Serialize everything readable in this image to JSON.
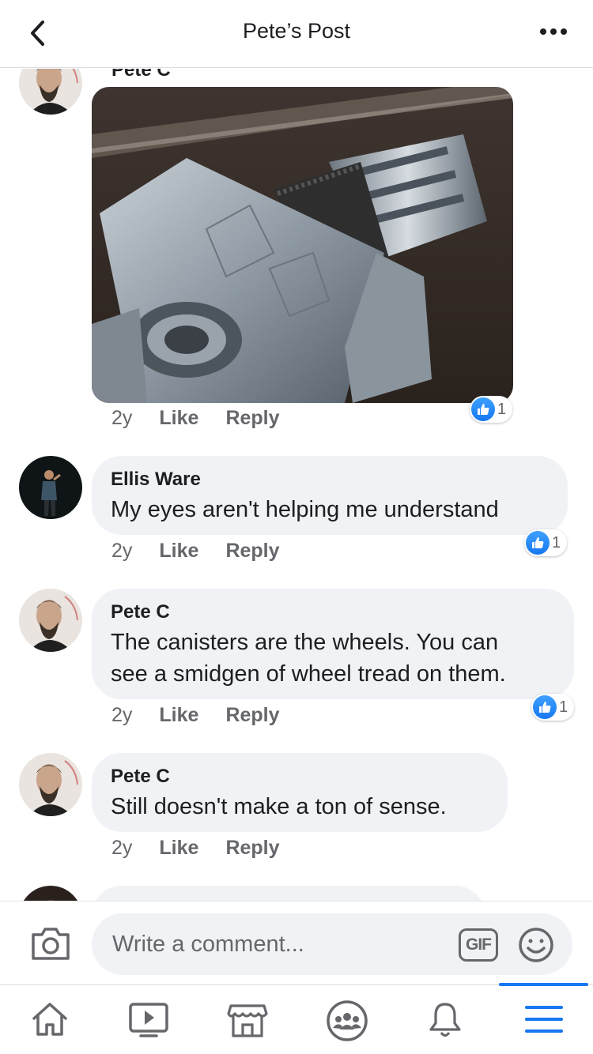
{
  "header": {
    "title": "Pete’s Post"
  },
  "comments": [
    {
      "name": "Pete C",
      "time": "2y",
      "like_label": "Like",
      "reply_label": "Reply",
      "reaction_count": "1"
    },
    {
      "name": "Ellis Ware",
      "text": "My eyes aren't helping me understand",
      "time": "2y",
      "like_label": "Like",
      "reply_label": "Reply",
      "reaction_count": "1"
    },
    {
      "name": "Pete C",
      "text_line1": "The canisters are the wheels. You can",
      "text_line2": "see a smidgen of wheel tread on them.",
      "time": "2y",
      "like_label": "Like",
      "reply_label": "Reply",
      "reaction_count": "1"
    },
    {
      "name": "Pete C",
      "text": "Still doesn't make a ton of sense.",
      "time": "2y",
      "like_label": "Like",
      "reply_label": "Reply"
    }
  ],
  "composer": {
    "placeholder": "Write a comment...",
    "gif_label": "GIF"
  },
  "tabbar": [
    "home-icon",
    "watch-icon",
    "marketplace-icon",
    "groups-icon",
    "notifications-icon",
    "menu-icon"
  ],
  "colors": {
    "accent": "#1877f2",
    "bubble": "#f0f2f5",
    "meta": "#65676b"
  }
}
